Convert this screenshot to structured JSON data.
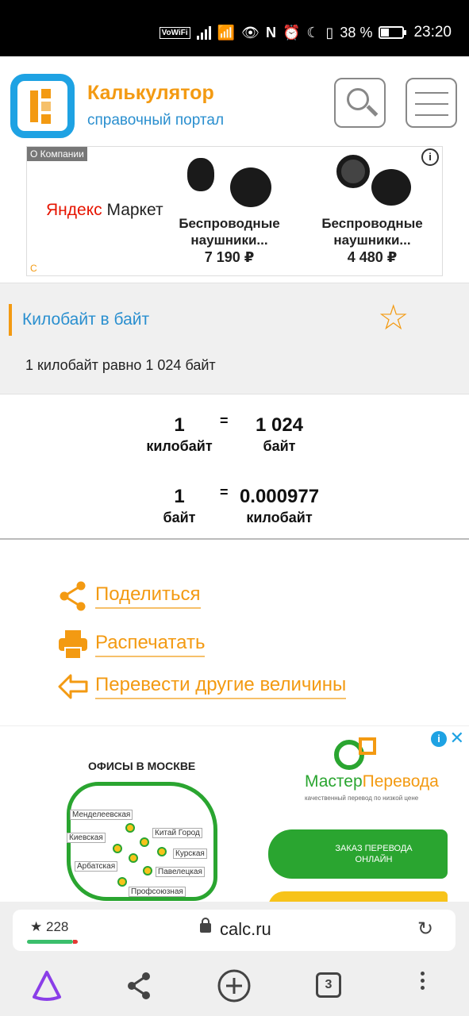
{
  "status_bar": {
    "volte": "VoWiFi",
    "battery": "38 %",
    "battery_level": 0.38,
    "time": "23:20"
  },
  "header": {
    "title": "Калькулятор",
    "subtitle": "справочный портал"
  },
  "ad_top": {
    "tag": "О Компании",
    "info": "i",
    "brand_left": "Яндекс",
    "brand_right": "Маркет",
    "products": [
      {
        "name_line1": "Беспроводные",
        "name_line2": "наушники...",
        "price": "7 190 ₽"
      },
      {
        "name_line1": "Беспроводные",
        "name_line2": "наушники...",
        "price": "4 480 ₽"
      }
    ],
    "corner": "C"
  },
  "converter": {
    "title": "Килобайт в байт",
    "description": "1 килобайт равно 1 024 байт"
  },
  "results": [
    {
      "left_value": "1",
      "left_unit": "килобайт",
      "eq": "=",
      "right_value": "1 024",
      "right_unit": "байт"
    },
    {
      "left_value": "1",
      "left_unit": "байт",
      "eq": "=",
      "right_value": "0.000977",
      "right_unit": "килобайт"
    }
  ],
  "actions": {
    "share": "Поделиться",
    "print": "Распечатать",
    "other": "Перевести другие величины"
  },
  "ad_bottom": {
    "info": "i",
    "close": "✕",
    "offices_title": "ОФИСЫ В МОСКВЕ",
    "stations": [
      "Менделеевская",
      "Киевская",
      "Китай Город",
      "Курская",
      "Арбатская",
      "Павелецкая",
      "Профсоюзная"
    ],
    "brand_a": "Мастер",
    "brand_b": "Перевода",
    "brand_sub": "качественный перевод по низкой цене",
    "button_line1": "ЗАКАЗ ПЕРЕВОДА",
    "button_line2": "ОНЛАЙН"
  },
  "address_bar": {
    "rating": "228",
    "url": "calc.ru"
  },
  "nav": {
    "tabs_count": "3"
  }
}
